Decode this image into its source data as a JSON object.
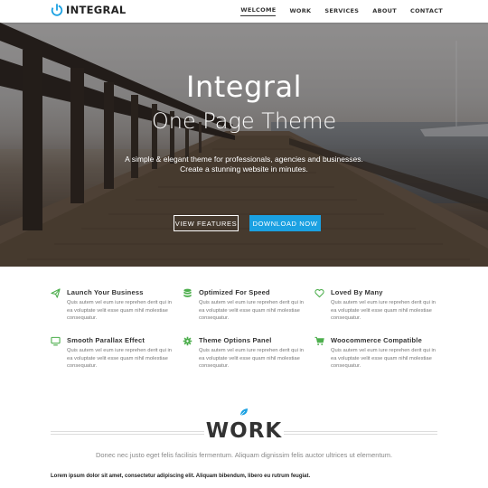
{
  "nav": {
    "logo_text": "INTEGRAL",
    "items": [
      {
        "label": "WELCOME",
        "active": true
      },
      {
        "label": "WORK",
        "active": false
      },
      {
        "label": "SERVICES",
        "active": false
      },
      {
        "label": "ABOUT",
        "active": false
      },
      {
        "label": "CONTACT",
        "active": false
      }
    ]
  },
  "hero": {
    "title": "Integral",
    "subtitle": "One Page Theme",
    "description_line1": "A simple & elegant theme for professionals, agencies and businesses.",
    "description_line2": "Create a stunning website in minutes.",
    "button_features": "VIEW FEATURES",
    "button_download": "DOWNLOAD NOW"
  },
  "features": [
    {
      "icon": "send-icon",
      "title": "Launch Your Business",
      "text": "Quis autem vel eum iure reprehen derit qui in ea voluptate velit esse quam nihil molestiae consequatur."
    },
    {
      "icon": "database-icon",
      "title": "Optimized For Speed",
      "text": "Quis autem vel eum iure reprehen derit qui in ea voluptate velit esse quam nihil molestiae consequatur."
    },
    {
      "icon": "heart-icon",
      "title": "Loved By Many",
      "text": "Quis autem vel eum iure reprehen derit qui in ea voluptate velit esse quam nihil molestiae consequatur."
    },
    {
      "icon": "monitor-icon",
      "title": "Smooth Parallax Effect",
      "text": "Quis autem vel eum iure reprehen derit qui in ea voluptate velit esse quam nihil molestiae consequatur."
    },
    {
      "icon": "gear-icon",
      "title": "Theme Options Panel",
      "text": "Quis autem vel eum iure reprehen derit qui in ea voluptate velit esse quam nihil molestiae consequatur."
    },
    {
      "icon": "cart-icon",
      "title": "Woocommerce Compatible",
      "text": "Quis autem vel eum iure reprehen derit qui in ea voluptate velit esse quam nihil molestiae consequatur."
    }
  ],
  "work": {
    "icon": "leaf-icon",
    "title": "WORK",
    "description": "Donec nec justo eget felis facilisis fermentum. Aliquam dignissim felis auctor ultrices ut elementum.",
    "lorem_bold": "Lorem ipsum dolor sit amet, consectetur adipiscing elit. Aliquam bibendum, libero eu rutrum feugiat."
  },
  "colors": {
    "accent": "#1ba1e2",
    "icon_green": "#4cae4c",
    "text_dark": "#333333"
  }
}
